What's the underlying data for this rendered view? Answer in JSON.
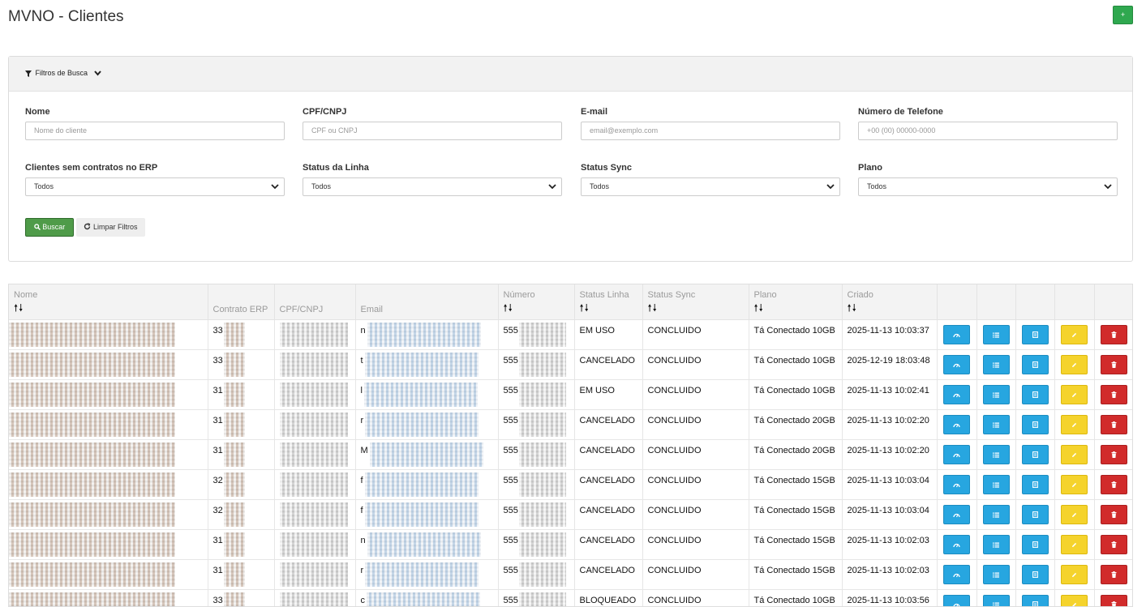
{
  "page": {
    "title": "MVNO - Clientes",
    "add_label": "+"
  },
  "filters": {
    "toggle_label": "Filtros de Busca",
    "fields": [
      {
        "label": "Nome",
        "placeholder": "Nome do cliente"
      },
      {
        "label": "CPF/CNPJ",
        "placeholder": "CPF ou CNPJ"
      },
      {
        "label": "E-mail",
        "placeholder": "email@exemplo.com"
      },
      {
        "label": "Número de Telefone",
        "placeholder": "+00 (00) 00000-0000"
      }
    ],
    "selects": [
      {
        "label": "Clientes sem contratos no ERP",
        "value": "Todos"
      },
      {
        "label": "Status da Linha",
        "value": "Todos"
      },
      {
        "label": "Status Sync",
        "value": "Todos"
      },
      {
        "label": "Plano",
        "value": "Todos"
      }
    ],
    "search_label": "Buscar",
    "clear_label": "Limpar Filtros"
  },
  "table": {
    "sort_symbol": "🠕🠗",
    "columns": {
      "nome": "Nome",
      "contrato": "Contrato ERP",
      "cpf": "CPF/CNPJ",
      "email": "Email",
      "numero": "Número",
      "status_linha": "Status Linha",
      "status_sync": "Status Sync",
      "plano": "Plano",
      "criado": "Criado"
    },
    "rows": [
      {
        "contrato": "33",
        "email": "n",
        "numero": "555",
        "status_linha": "EM USO",
        "status_sync": "CONCLUIDO",
        "plano": "Tá Conectado 10GB",
        "criado": "2025-11-13 10:03:37"
      },
      {
        "contrato": "33",
        "email": "t",
        "numero": "555",
        "status_linha": "CANCELADO",
        "status_sync": "CONCLUIDO",
        "plano": "Tá Conectado 10GB",
        "criado": "2025-12-19 18:03:48"
      },
      {
        "contrato": "31",
        "email": "l",
        "numero": "555",
        "status_linha": "EM USO",
        "status_sync": "CONCLUIDO",
        "plano": "Tá Conectado 10GB",
        "criado": "2025-11-13 10:02:41"
      },
      {
        "contrato": "31",
        "email": "r",
        "numero": "555",
        "status_linha": "CANCELADO",
        "status_sync": "CONCLUIDO",
        "plano": "Tá Conectado 20GB",
        "criado": "2025-11-13 10:02:20"
      },
      {
        "contrato": "31",
        "email": "M",
        "numero": "555",
        "status_linha": "CANCELADO",
        "status_sync": "CONCLUIDO",
        "plano": "Tá Conectado 20GB",
        "criado": "2025-11-13 10:02:20"
      },
      {
        "contrato": "32",
        "email": "f",
        "numero": "555",
        "status_linha": "CANCELADO",
        "status_sync": "CONCLUIDO",
        "plano": "Tá Conectado 15GB",
        "criado": "2025-11-13 10:03:04"
      },
      {
        "contrato": "32",
        "email": "f",
        "numero": "555",
        "status_linha": "CANCELADO",
        "status_sync": "CONCLUIDO",
        "plano": "Tá Conectado 15GB",
        "criado": "2025-11-13 10:03:04"
      },
      {
        "contrato": "31",
        "email": "n",
        "numero": "555",
        "status_linha": "CANCELADO",
        "status_sync": "CONCLUIDO",
        "plano": "Tá Conectado 15GB",
        "criado": "2025-11-13 10:02:03"
      },
      {
        "contrato": "31",
        "email": "r",
        "numero": "555",
        "status_linha": "CANCELADO",
        "status_sync": "CONCLUIDO",
        "plano": "Tá Conectado 15GB",
        "criado": "2025-11-13 10:02:03"
      },
      {
        "contrato": "33",
        "email": "c",
        "numero": "555",
        "status_linha": "BLOQUEADO",
        "status_sync": "CONCLUIDO",
        "plano": "Tá Conectado 10GB",
        "criado": "2025-11-13 10:03:56"
      }
    ]
  },
  "colors": {
    "primary_action": "#27a6e0",
    "edit": "#f5d32c",
    "delete": "#d12b2b",
    "success": "#4f9b49"
  },
  "icons": {
    "funnel": "filter-icon",
    "chevron": "chevron-down-icon",
    "search": "search-icon",
    "refresh": "refresh-icon",
    "gauge": "gauge-icon",
    "list": "list-icon",
    "doc": "document-icon",
    "edit": "pencil-icon",
    "delete": "trash-icon"
  }
}
